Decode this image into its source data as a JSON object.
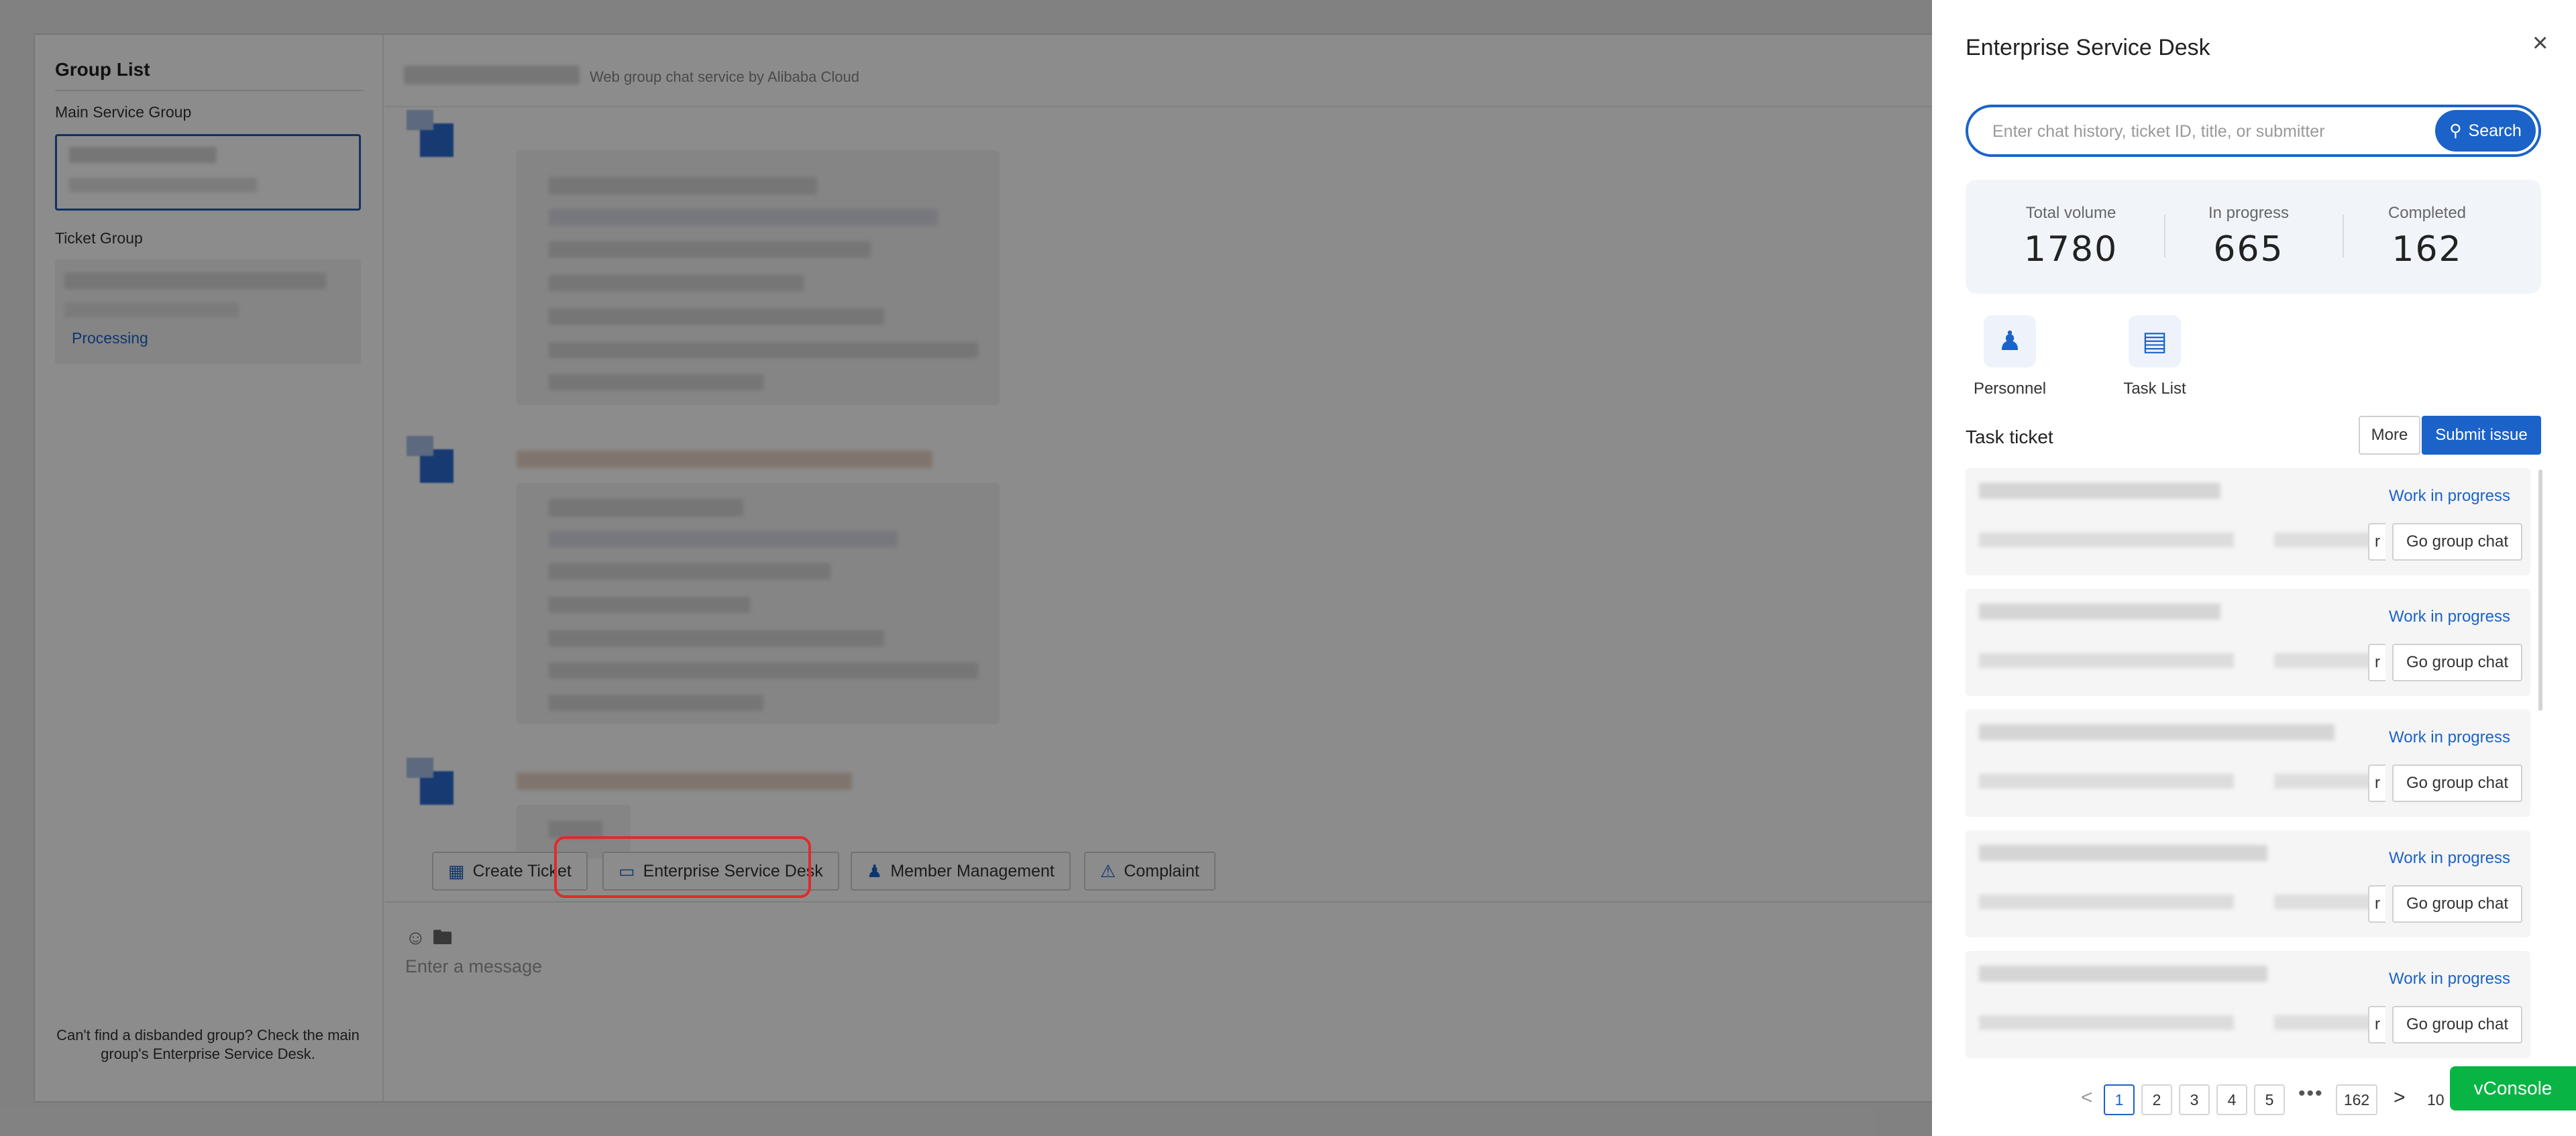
{
  "sidebar": {
    "title": "Group List",
    "main_group_label": "Main Service Group",
    "ticket_group_label": "Ticket Group",
    "ticket_group_status": "Processing",
    "footer": "Can't find a disbanded group? Check the main group's Enterprise Service Desk."
  },
  "chat": {
    "subtitle": "Web group chat service by Alibaba Cloud",
    "toolbar": {
      "create_ticket": "Create Ticket",
      "service_desk": "Enterprise Service Desk",
      "member_management": "Member Management",
      "complaint": "Complaint"
    },
    "input_placeholder": "Enter a message"
  },
  "drawer": {
    "title": "Enterprise Service Desk",
    "close": "×",
    "search": {
      "placeholder": "Enter chat history, ticket ID, title, or submitter",
      "button": "Search"
    },
    "stats": [
      {
        "label": "Total volume",
        "value": "1780"
      },
      {
        "label": "In progress",
        "value": "665"
      },
      {
        "label": "Completed",
        "value": "162"
      }
    ],
    "quick_links": [
      {
        "label": "Personnel",
        "icon": "person-icon"
      },
      {
        "label": "Task List",
        "icon": "task-list-icon"
      }
    ],
    "section_title": "Task ticket",
    "more_button": "More",
    "submit_button": "Submit issue",
    "tickets": [
      {
        "status": "Work in progress",
        "partial": "r",
        "action": "Go group chat"
      },
      {
        "status": "Work in progress",
        "partial": "r",
        "action": "Go group chat"
      },
      {
        "status": "Work in progress",
        "partial": "r",
        "action": "Go group chat"
      },
      {
        "status": "Work in progress",
        "partial": "r",
        "action": "Go group chat"
      },
      {
        "status": "Work in progress",
        "partial": "r",
        "action": "Go group chat"
      }
    ],
    "pagination": {
      "prev": "<",
      "pages": [
        "1",
        "2",
        "3",
        "4",
        "5"
      ],
      "ellipsis": "•••",
      "last": "162",
      "next": ">",
      "size_partial": "10"
    }
  },
  "vconsole": "vConsole",
  "colors": {
    "accent": "#1b63c9",
    "highlight": "#e02b2b",
    "vconsole": "#08b544"
  }
}
